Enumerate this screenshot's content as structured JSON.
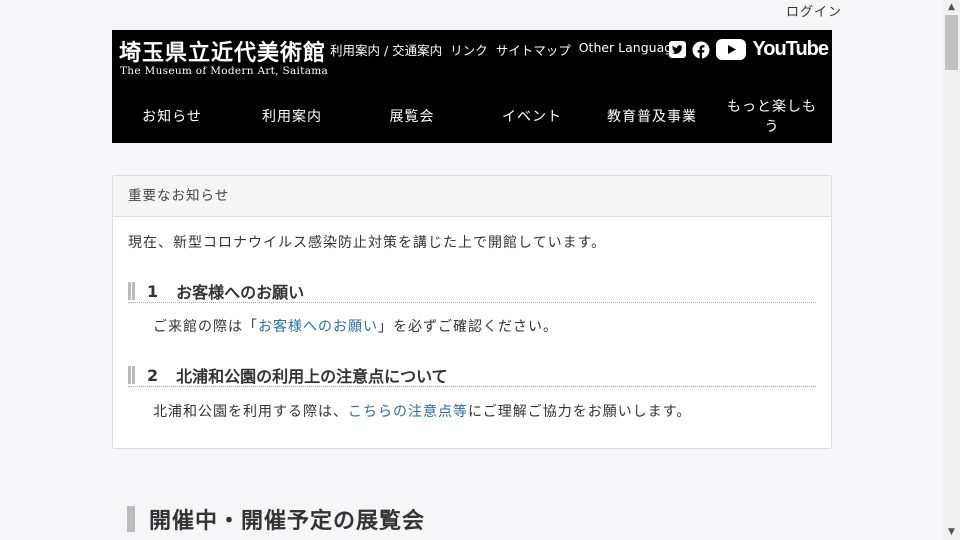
{
  "login": "ログイン",
  "header": {
    "logo_jp": "埼玉県立近代美術館",
    "logo_en": "The Museum of Modern Art, Saitama",
    "links": [
      "利用案内 / 交通案内",
      "リンク",
      "サイトマップ",
      "Other Languages"
    ],
    "youtube_label": "YouTube"
  },
  "nav": [
    "お知らせ",
    "利用案内",
    "展覧会",
    "イベント",
    "教育普及事業",
    "もっと楽しもう"
  ],
  "notice": {
    "heading": "重要なお知らせ",
    "intro": "現在、新型コロナウイルス感染防止対策を講じた上で開館しています。",
    "sections": [
      {
        "num": "1",
        "title": "お客様へのお願い",
        "body_pre": "ご来館の際は「",
        "body_link": "お客様へのお願い",
        "body_post": "」を必ずご確認ください。"
      },
      {
        "num": "2",
        "title": "北浦和公園の利用上の注意点について",
        "body_pre": "北浦和公園を利用する際は、",
        "body_link": "こちらの注意点等",
        "body_post": "にご理解ご協力をお願いします。"
      }
    ]
  },
  "exhibitions_heading": "開催中・開催予定の展覧会",
  "colors": {
    "header_bg": "#000000",
    "link": "#2a6ea6",
    "accent_bar": "#bbbbbb"
  }
}
